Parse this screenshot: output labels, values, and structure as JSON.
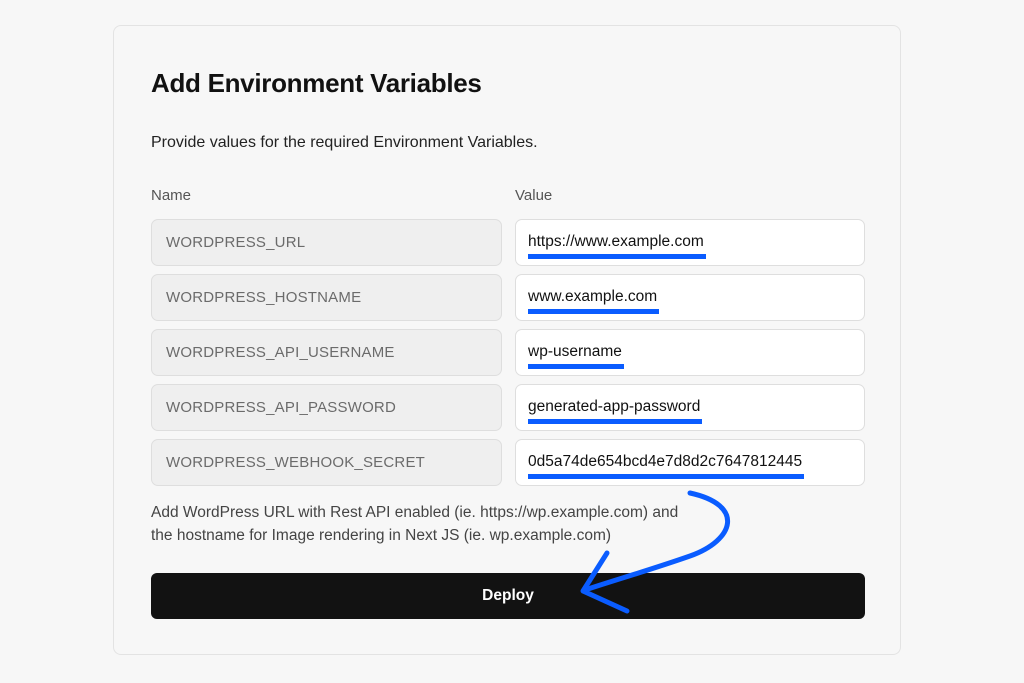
{
  "card": {
    "title": "Add Environment Variables",
    "description": "Provide values for the required Environment Variables.",
    "columns": {
      "name": "Name",
      "value": "Value"
    },
    "variables": [
      {
        "name": "WORDPRESS_URL",
        "value": "https://www.example.com"
      },
      {
        "name": "WORDPRESS_HOSTNAME",
        "value": "www.example.com"
      },
      {
        "name": "WORDPRESS_API_USERNAME",
        "value": "wp-username"
      },
      {
        "name": "WORDPRESS_API_PASSWORD",
        "value": "generated-app-password"
      },
      {
        "name": "WORDPRESS_WEBHOOK_SECRET",
        "value": "0d5a74de654bcd4e7d8d2c7647812445"
      }
    ],
    "help_line1": "Add WordPress URL with Rest API enabled (ie. https://wp.example.com) and",
    "help_line2": "the hostname for Image rendering in Next JS (ie. wp.example.com)",
    "deploy_label": "Deploy"
  },
  "colors": {
    "underline_highlight": "#0a5cff",
    "arrow": "#0a5cff",
    "button_bg": "#121212"
  }
}
